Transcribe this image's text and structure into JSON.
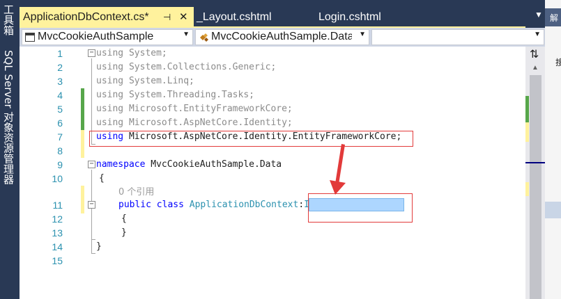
{
  "side_toolbar": {
    "toolbox_label": "工具箱",
    "sql_explorer_label": "SQL Server 对象资源管理器"
  },
  "tabs": [
    {
      "label": "ApplicationDbContext.cs*",
      "active": true
    },
    {
      "label": "_Layout.cshtml",
      "active": false
    },
    {
      "label": "Login.cshtml",
      "active": false
    }
  ],
  "tab_icons": {
    "pin": "⊣",
    "close": "✕",
    "overflow": "▼"
  },
  "navbar": {
    "project": "MvcCookieAuthSample",
    "namespace": "MvcCookieAuthSample.Data",
    "member": ""
  },
  "colors": {
    "keyword": "#0000ff",
    "type": "#2b91af",
    "active_tab": "#fff29d",
    "chrome": "#293955"
  },
  "code": {
    "lines": [
      {
        "n": "1",
        "tokens": [
          {
            "t": "using System;",
            "c": "gray"
          }
        ]
      },
      {
        "n": "2",
        "tokens": [
          {
            "t": "using System.Collections.Generic;",
            "c": "gray"
          }
        ]
      },
      {
        "n": "3",
        "tokens": [
          {
            "t": "using System.Linq;",
            "c": "gray"
          }
        ]
      },
      {
        "n": "4",
        "tokens": [
          {
            "t": "using System.Threading.Tasks;",
            "c": "gray"
          }
        ]
      },
      {
        "n": "5",
        "tokens": [
          {
            "t": "using Microsoft.EntityFrameworkCore;",
            "c": "gray"
          }
        ]
      },
      {
        "n": "6",
        "tokens": [
          {
            "t": "using Microsoft.AspNetCore.Identity;",
            "c": "gray"
          }
        ]
      },
      {
        "n": "7",
        "tokens": [
          {
            "t": "using",
            "c": "kw"
          },
          {
            "t": " Microsoft.AspNetCore.Identity.EntityFrameworkCore;",
            "c": ""
          }
        ]
      },
      {
        "n": "8",
        "tokens": []
      },
      {
        "n": "9",
        "tokens": [
          {
            "t": "namespace",
            "c": "kw"
          },
          {
            "t": " MvcCookieAuthSample.Data",
            "c": ""
          }
        ]
      },
      {
        "n": "10",
        "tokens": [
          {
            "t": "{",
            "c": ""
          }
        ]
      },
      {
        "n": "11",
        "tokens": [
          {
            "t": "public",
            "c": "kw"
          },
          {
            "t": " ",
            "c": ""
          },
          {
            "t": "class",
            "c": "kw"
          },
          {
            "t": " ",
            "c": ""
          },
          {
            "t": "ApplicationDbContext",
            "c": "type"
          },
          {
            "t": ":",
            "c": ""
          },
          {
            "t": "IdentityDbContext",
            "c": "type"
          }
        ]
      },
      {
        "n": "12",
        "tokens": [
          {
            "t": "{",
            "c": ""
          }
        ]
      },
      {
        "n": "13",
        "tokens": [
          {
            "t": "}",
            "c": ""
          }
        ]
      },
      {
        "n": "14",
        "tokens": [
          {
            "t": "}",
            "c": ""
          }
        ]
      },
      {
        "n": "15",
        "tokens": []
      }
    ],
    "codelens": "0 个引用"
  },
  "right_panel": {
    "top_glyph": "解",
    "search_glyph": "搜"
  }
}
